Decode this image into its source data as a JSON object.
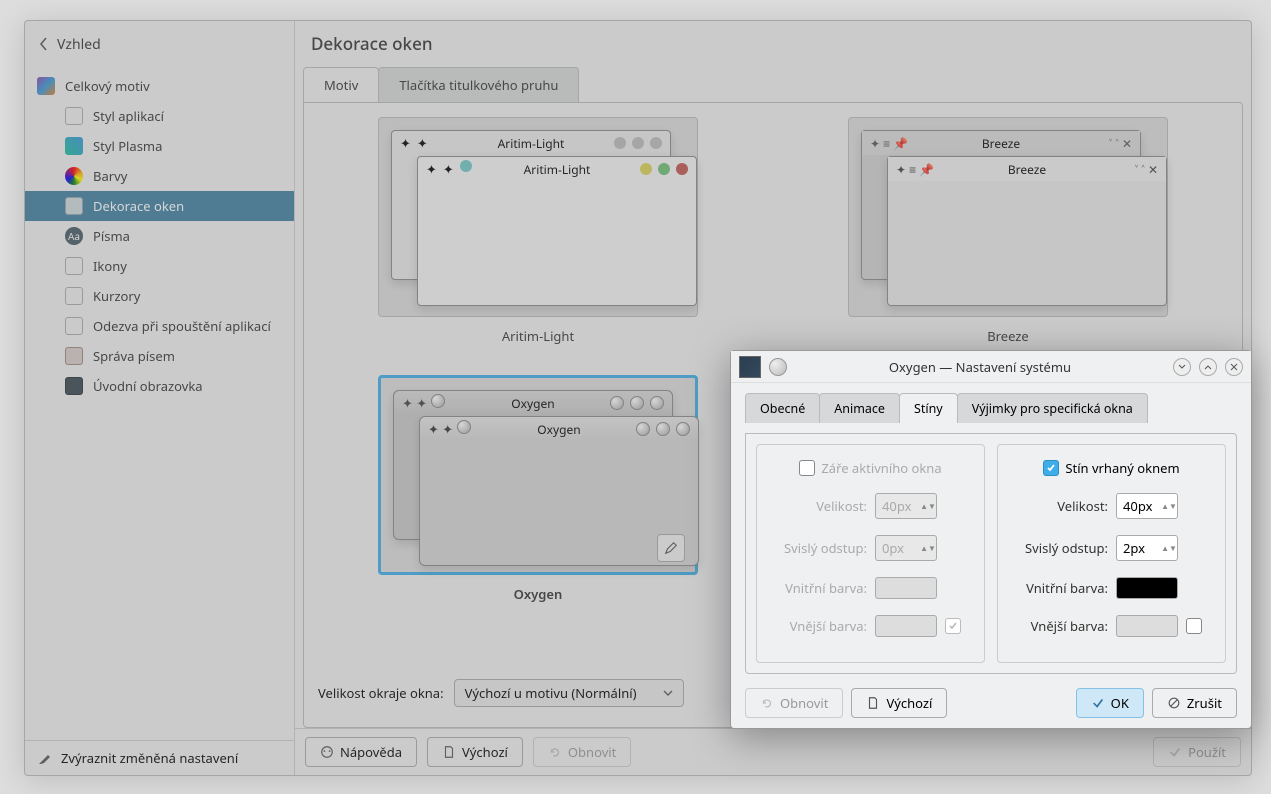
{
  "sidebar": {
    "back_label": "Vzhled",
    "category": "Celkový motiv",
    "items": [
      "Styl aplikací",
      "Styl Plasma",
      "Barvy",
      "Dekorace oken",
      "Písma",
      "Ikony",
      "Kurzory",
      "Odezva při spouštění aplikací",
      "Správa písem",
      "Úvodní obrazovka"
    ],
    "selected_index": 3,
    "highlight_changed": "Zvýraznit změněná nastavení"
  },
  "main": {
    "title": "Dekorace oken",
    "tabs": [
      "Motiv",
      "Tlačítka titulkového pruhu"
    ],
    "active_tab": 0,
    "themes": [
      {
        "name": "Aritim-Light",
        "selected": false,
        "bold": false
      },
      {
        "name": "Breeze",
        "selected": false,
        "bold": false
      },
      {
        "name": "Oxygen",
        "selected": true,
        "bold": true
      }
    ],
    "border_label": "Velikost okraje okna:",
    "border_value": "Výchozí u motivu (Normální)",
    "actions": {
      "help": "Nápověda",
      "defaults": "Výchozí",
      "refresh": "Obnovit",
      "apply": "Použít"
    }
  },
  "dialog": {
    "title": "Oxygen — Nastavení systému",
    "tabs": [
      "Obecné",
      "Animace",
      "Stíny",
      "Výjimky pro specifická okna"
    ],
    "active_tab": 2,
    "glow": {
      "title": "Záře aktivního okna",
      "enabled": false,
      "size_label": "Velikost:",
      "size_value": "40px",
      "offset_label": "Svislý odstup:",
      "offset_value": "0px",
      "inner_label": "Vnitřní barva:",
      "outer_label": "Vnější barva:"
    },
    "shadow": {
      "title": "Stín vrhaný oknem",
      "enabled": true,
      "size_label": "Velikost:",
      "size_value": "40px",
      "offset_label": "Svislý odstup:",
      "offset_value": "2px",
      "inner_label": "Vnitřní barva:",
      "inner_color": "#000000",
      "outer_label": "Vnější barva:"
    },
    "buttons": {
      "reset": "Obnovit",
      "defaults": "Výchozí",
      "ok": "OK",
      "cancel": "Zrušit"
    }
  }
}
